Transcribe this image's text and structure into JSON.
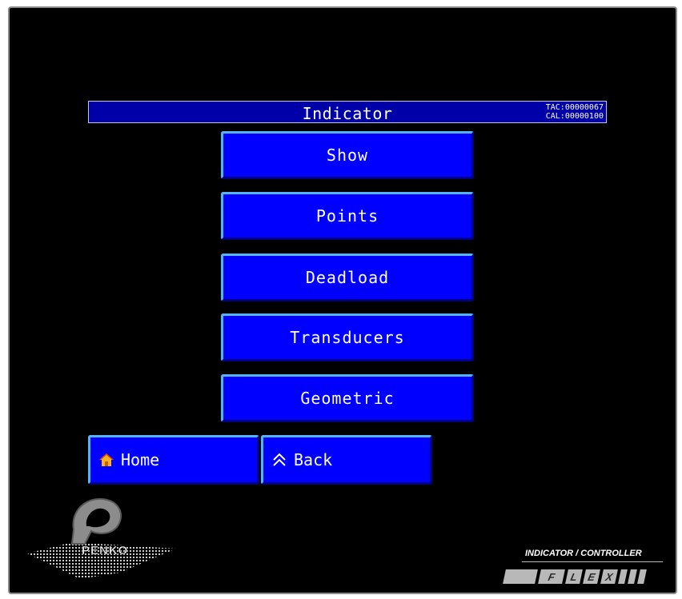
{
  "screen": {
    "title": "Indicator",
    "tac": "TAC:00000067",
    "cal": "CAL:00000100"
  },
  "menu": [
    {
      "label": "Show"
    },
    {
      "label": "Points"
    },
    {
      "label": "Deadload"
    },
    {
      "label": "Transducers"
    },
    {
      "label": "Geometric"
    }
  ],
  "nav": {
    "home_label": "Home",
    "home_icon": "home-icon",
    "back_label": "Back",
    "back_icon": "double-chevron-up-icon"
  },
  "branding": {
    "company": "PENKO",
    "product_line": "INDICATOR / CONTROLLER",
    "product_letters": [
      "F",
      "L",
      "E",
      "X"
    ]
  },
  "colors": {
    "background": "#000000",
    "button": "#0000ff",
    "title_bar": "#0000a8"
  }
}
